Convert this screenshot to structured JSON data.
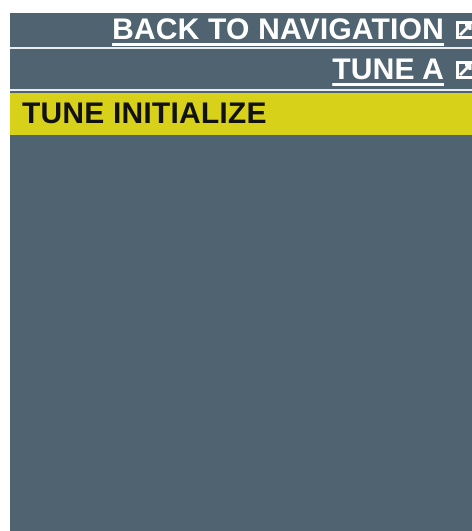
{
  "menu": {
    "items": [
      {
        "label": "BACK TO NAVIGATION",
        "icon": "external-link-icon"
      },
      {
        "label": "TUNE A",
        "icon": "external-link-icon"
      },
      {
        "label": "TUNE INITIALIZE",
        "selected": true
      }
    ]
  },
  "colors": {
    "background": "#4f6470",
    "highlight": "#d8d11a",
    "text": "#ffffff",
    "highlight_text": "#111111"
  }
}
